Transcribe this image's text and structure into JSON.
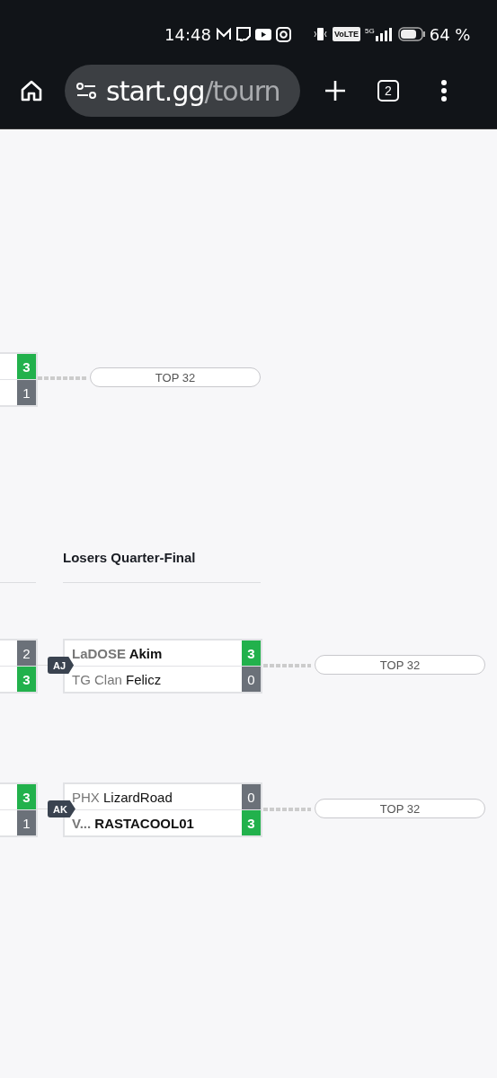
{
  "status_bar": {
    "time": "14:48",
    "network": "5G",
    "volte": "VoLTE",
    "battery": "64 %"
  },
  "browser": {
    "url_host": "start.gg",
    "url_path": "/tourn",
    "tab_count": "2"
  },
  "upper_round": {
    "left_match": {
      "slots": [
        {
          "score": "3",
          "winner": true
        },
        {
          "score": "1",
          "winner": false
        }
      ]
    },
    "next": "TOP 32"
  },
  "losers_round": {
    "title": "Losers Quarter-Final",
    "matches": [
      {
        "badge": "AJ",
        "left_slots": [
          {
            "score": "2",
            "winner": false
          },
          {
            "score": "3",
            "winner": true
          }
        ],
        "players": [
          {
            "prefix": "LaDOSE",
            "name": "Akim",
            "score": "3",
            "winner": true
          },
          {
            "prefix": "TG Clan",
            "name": "Felicz",
            "score": "0",
            "winner": false
          }
        ],
        "next": "TOP 32"
      },
      {
        "badge": "AK",
        "left_slots": [
          {
            "score": "3",
            "winner": true
          },
          {
            "score": "1",
            "winner": false
          }
        ],
        "players": [
          {
            "prefix": "PHX",
            "name": "LizardRoad",
            "score": "0",
            "winner": false
          },
          {
            "prefix": "V...",
            "name": "RASTACOOL01",
            "score": "3",
            "winner": true
          }
        ],
        "next": "TOP 32"
      }
    ]
  }
}
